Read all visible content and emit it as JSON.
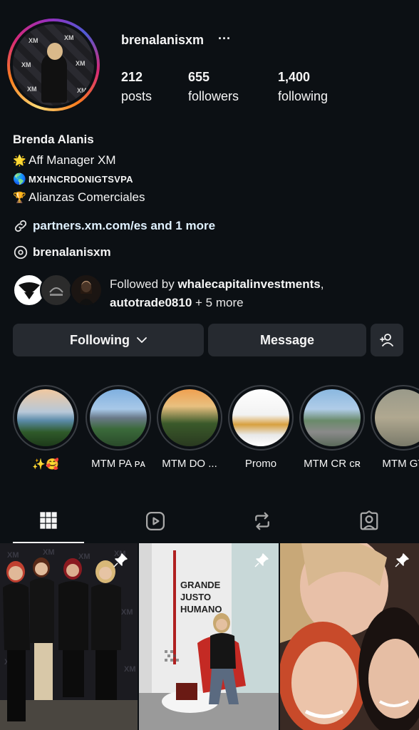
{
  "profile": {
    "username": "brenalanisxm",
    "more": "···",
    "stats": {
      "posts_count": "212",
      "posts_label": "posts",
      "followers_count": "655",
      "followers_label": "followers",
      "following_count": "1,400",
      "following_label": "following"
    },
    "bio": {
      "name": "Brenda Alanis",
      "line1_emoji": "🌟",
      "line1": "Aff Manager XM",
      "line2_emoji": "🌎",
      "line2": "MXHNCRDONIGTSVPA",
      "line3_emoji": "🏆",
      "line3": "Alianzas Comerciales",
      "link": "partners.xm.com/es and 1 more",
      "threads": "brenalanisxm"
    },
    "followed_by": {
      "prefix": "Followed by ",
      "user1": "whalecapitalinvestments",
      "comma": ",",
      "user2": "autotrade0810",
      "suffix": " + 5 more"
    }
  },
  "buttons": {
    "following": "Following",
    "message": "Message"
  },
  "highlights": [
    {
      "label": "✨🥰"
    },
    {
      "label": "MTM PA ᴘᴀ"
    },
    {
      "label": "MTM DO ..."
    },
    {
      "label": "Promo"
    },
    {
      "label": "MTM CR ᴄʀ"
    },
    {
      "label": "MTM GT"
    }
  ],
  "post_texts": {
    "post2_sign": "GRANDE JUSTO HUMANO",
    "avatar_logo": "XM"
  },
  "colors": {
    "background": "#0c1014",
    "button": "#262a30",
    "text": "#f5f5f5"
  },
  "icons": {
    "tabs": [
      "grid-icon",
      "reels-icon",
      "reposts-icon",
      "tagged-icon"
    ]
  }
}
